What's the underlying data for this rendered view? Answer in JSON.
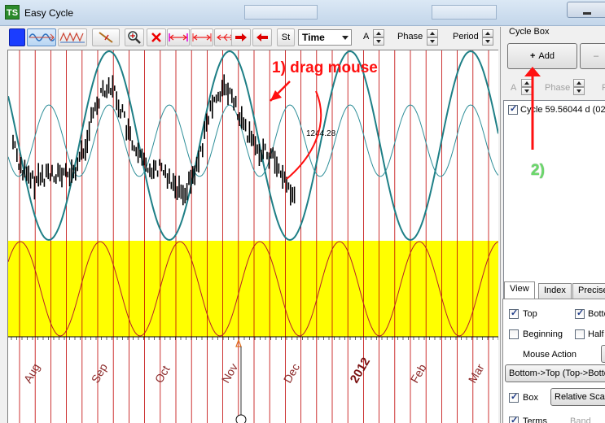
{
  "window": {
    "title": "Easy Cycle",
    "logo": "TS"
  },
  "toolbar": {
    "buttons": [
      {
        "name": "color-swatch-button",
        "icon": "blue-square-icon",
        "active": false
      },
      {
        "name": "sine-wave-tool-button",
        "icon": "sine-wave-icon",
        "active": true
      },
      {
        "name": "triangle-wave-tool-button",
        "icon": "triangle-wave-icon",
        "active": false
      },
      {
        "name": "trendline-tool-button",
        "icon": "trendline-icon",
        "active": false
      },
      {
        "name": "zoom-button",
        "icon": "magnifier-icon",
        "active": false
      },
      {
        "name": "delete-button",
        "icon": "red-x-icon",
        "active": false
      },
      {
        "name": "span-arrows-button",
        "icon": "double-arrow-icon",
        "active": false
      },
      {
        "name": "span-arrows-red-button",
        "icon": "double-arrow-red-icon",
        "active": false
      },
      {
        "name": "span-split-button",
        "icon": "split-arrow-icon",
        "active": false
      },
      {
        "name": "arrow-right-button",
        "icon": "arrow-right-icon",
        "active": false
      },
      {
        "name": "arrow-left-button",
        "icon": "arrow-left-icon",
        "active": false
      }
    ],
    "st_label": "St",
    "time_select": "Time",
    "a_label": "A",
    "phase_label": "Phase",
    "period_label": "Period"
  },
  "cycle_box": {
    "title": "Cycle Box",
    "add_label": "Add",
    "remove_label": "–",
    "a_label": "A",
    "phase_label": "Phase",
    "p_label": "P",
    "items": [
      {
        "checked": true,
        "label": "Cycle 59.56044 d (02."
      }
    ]
  },
  "tabs": [
    {
      "label": "View",
      "selected": true
    },
    {
      "label": "Index",
      "selected": false
    },
    {
      "label": "Precise",
      "selected": false
    }
  ],
  "view_tab": {
    "top_label": "Top",
    "top_checked": true,
    "bottom_label": "Botto",
    "bottom_checked": true,
    "beginning_label": "Beginning",
    "beginning_checked": false,
    "half_label": "Half Y",
    "half_checked": false,
    "mouse_action_label": "Mouse Action",
    "mouse_action_value": "Bottom->Top (Top->Botto",
    "box_label": "Box",
    "box_checked": true,
    "relative_scale_label": "Relative Scale",
    "terms_label": "Terms",
    "terms_checked": true,
    "band_label": "Band"
  },
  "chart": {
    "price_label": "1244.28",
    "months": [
      "Aug",
      "Sep",
      "Oct",
      "Nov",
      "Dec",
      "2012",
      "Feb",
      "Mar"
    ]
  },
  "annotations": {
    "step1": "1) drag mouse",
    "step2": "2)"
  },
  "colors": {
    "primary_cycle": "#1e7f86",
    "secondary_cycle": "#2f8f99",
    "lower_cycle": "#b8202a",
    "band": "#ffff00",
    "grid": "#c00000",
    "annotation": "#ff1010",
    "annotation_text": "#ff1a1a",
    "annotation_green": "#6bd96b"
  }
}
